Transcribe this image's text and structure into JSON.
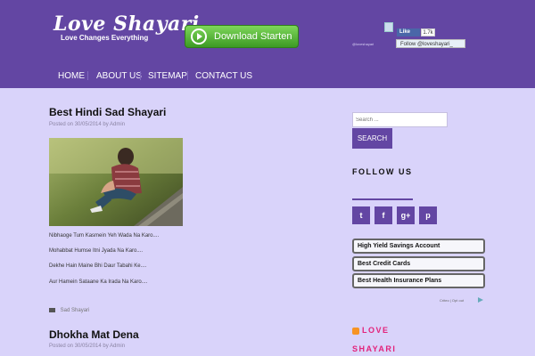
{
  "header": {
    "logo_title": "Love Shayari",
    "logo_tagline": "Love Changes Everything",
    "download_label": "Download Starten",
    "fb_like_label": "Like",
    "fb_like_count": "1.7k",
    "twitter_follow_label": "Follow @loveshayari_",
    "small_handle": "@loveshayari"
  },
  "nav": {
    "items": [
      "HOME",
      "ABOUT US",
      "SITEMAP",
      "CONTACT US"
    ]
  },
  "posts": [
    {
      "title": "Best Hindi Sad Shayari",
      "meta": "Posted on 30/05/2014 by Admin",
      "lines": [
        "Nibhaoge Tum Kasmein Yeh Wada Na Karo....",
        "Mohabbat Humse Itni Jyada Na Karo....",
        "Dekhe Hain Maine Bhi Daur Tabahi Ke....",
        "Aur Hamein Sataane Ka Irada Na Karo...."
      ],
      "category": "Sad Shayari"
    },
    {
      "title": "Dhokha Mat Dena",
      "meta": "Posted on 30/05/2014 by Admin"
    }
  ],
  "sidebar": {
    "search_placeholder": "Search ...",
    "search_button": "SEARCH",
    "follow_title": "FOLLOW US",
    "social_icons": [
      "twitter-icon",
      "facebook-icon",
      "google-plus-icon",
      "pinterest-icon"
    ],
    "social_glyphs": [
      "t",
      "f",
      "g+",
      "p"
    ],
    "ads": [
      "High Yield Savings Account",
      "Best Credit Cards",
      "Best Health Insurance Plans"
    ],
    "adchoices": "Criteo | Opt out",
    "feed_title_1": "LOVE",
    "feed_title_2": "SHAYARI"
  },
  "colors": {
    "brand_purple": "#6346a3",
    "page_bg": "#d9d3fa",
    "feed_title_pink": "#e3237b",
    "download_green": "#4caf2f"
  }
}
